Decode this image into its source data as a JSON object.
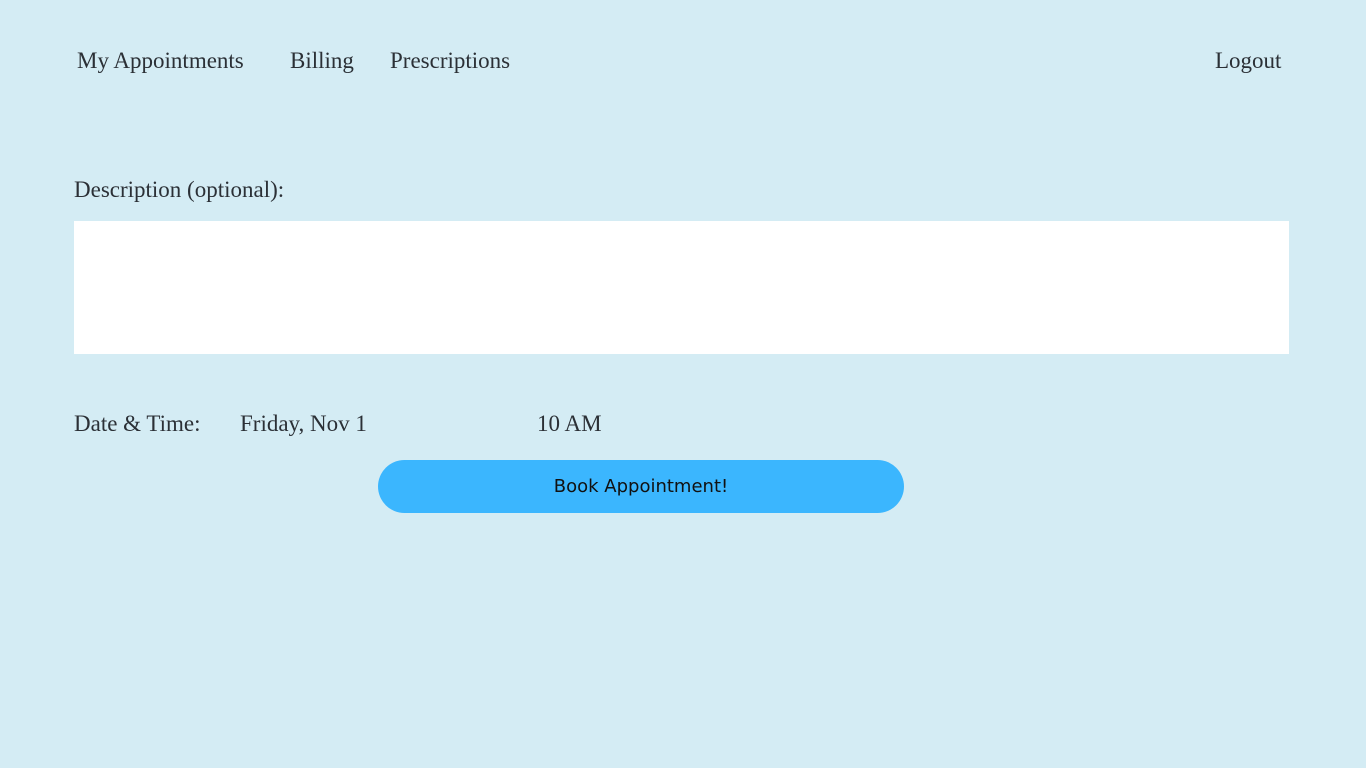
{
  "nav": {
    "items": [
      {
        "label": "My Appointments"
      },
      {
        "label": "Billing"
      },
      {
        "label": "Prescriptions"
      }
    ],
    "logout": "Logout"
  },
  "form": {
    "description_label": "Description (optional):",
    "description_value": "",
    "datetime_label": "Date & Time:",
    "date_value": "Friday, Nov 1",
    "time_value": "10 AM",
    "submit_label": "Book Appointment!"
  },
  "colors": {
    "background": "#d4ecf4",
    "button": "#3bb6fe",
    "text": "#2b3036"
  }
}
